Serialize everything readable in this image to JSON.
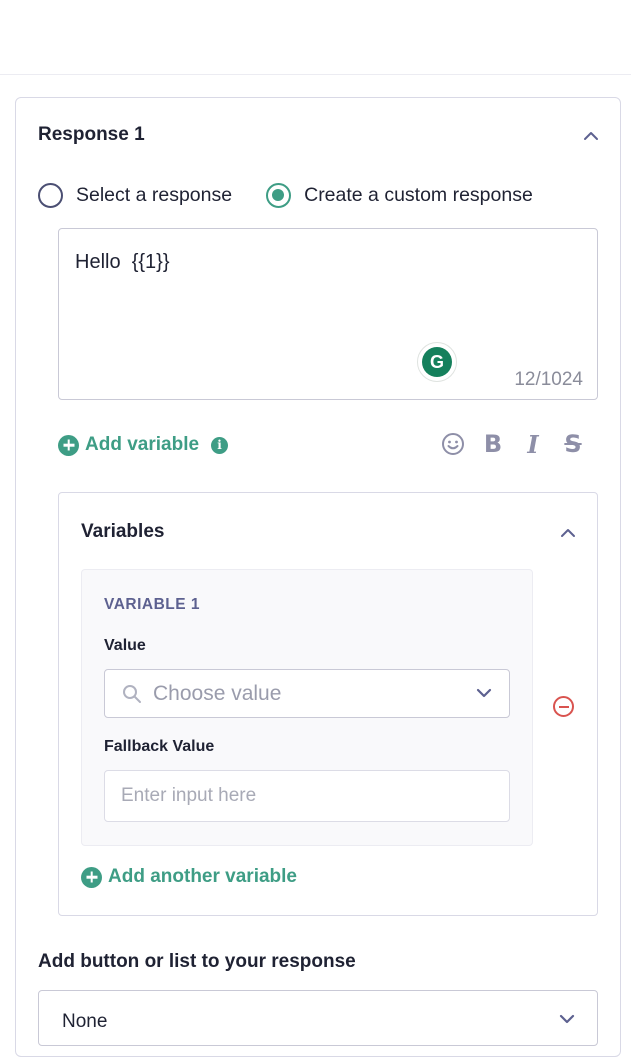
{
  "response": {
    "title": "Response 1",
    "options": [
      {
        "label": "Select a response",
        "checked": false
      },
      {
        "label": "Create a custom response",
        "checked": true
      }
    ],
    "message_text": "Hello  {{1}}",
    "char_counter": "12/1024",
    "grammarly_letter": "G",
    "add_variable_label": "Add variable",
    "info_glyph": "i",
    "formatting": {
      "emoji_icon": "smiley-icon",
      "bold_glyph": "B",
      "italic_glyph": "I",
      "strike_glyph": "S"
    }
  },
  "variables": {
    "title": "Variables",
    "items": [
      {
        "label": "VARIABLE 1",
        "value_label": "Value",
        "value_placeholder": "Choose value",
        "fallback_label": "Fallback Value",
        "fallback_placeholder": "Enter input here"
      }
    ],
    "add_another_label": "Add another variable"
  },
  "buttons_section": {
    "title": "Add button or list to your response",
    "selected": "None"
  },
  "colors": {
    "accent": "#3e9d85",
    "danger": "#d9534f",
    "muted_icon": "#8e8fa8",
    "border": "#c9c9d6"
  }
}
